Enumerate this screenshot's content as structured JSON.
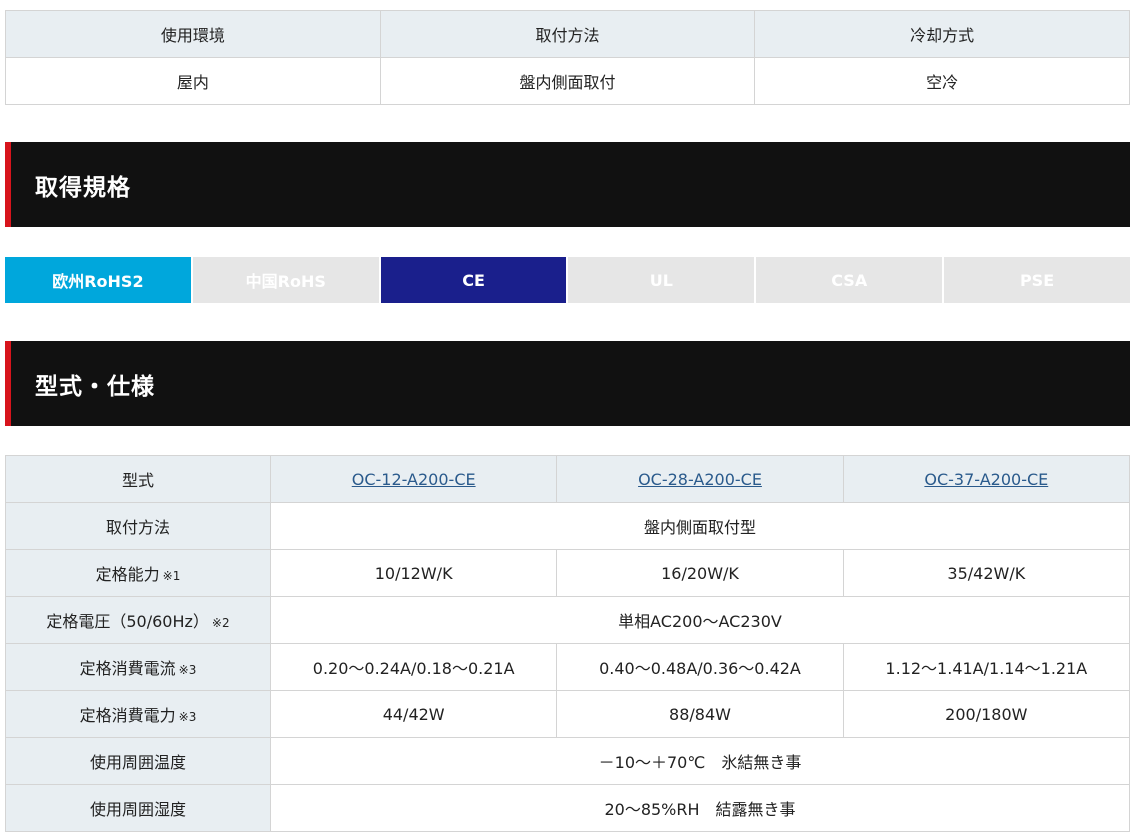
{
  "environment": {
    "headers": [
      "使用環境",
      "取付方法",
      "冷却方式"
    ],
    "values": [
      "屋内",
      "盤内側面取付",
      "空冷"
    ]
  },
  "certification": {
    "title": "取得規格",
    "items": [
      {
        "label": "欧州RoHS2",
        "state": "active",
        "color": "#00a7dc"
      },
      {
        "label": "中国RoHS",
        "state": "inactive"
      },
      {
        "label": "CE",
        "state": "active",
        "color": "#1a1f8c"
      },
      {
        "label": "UL",
        "state": "inactive"
      },
      {
        "label": "CSA",
        "state": "inactive"
      },
      {
        "label": "PSE",
        "state": "inactive"
      }
    ]
  },
  "spec": {
    "title": "型式・仕様",
    "model_label": "型式",
    "models": [
      "OC-12-A200-CE",
      "OC-28-A200-CE",
      "OC-37-A200-CE"
    ],
    "rows": {
      "mount": {
        "label": "取付方法",
        "value": "盤内側面取付型"
      },
      "capacity": {
        "label": "定格能力",
        "note": "※1",
        "values": [
          "10/12W/K",
          "16/20W/K",
          "35/42W/K"
        ]
      },
      "voltage": {
        "label": "定格電圧（50/60Hz）",
        "note": "※2",
        "value": "単相AC200～AC230V"
      },
      "current": {
        "label": "定格消費電流",
        "note": "※3",
        "values": [
          "0.20～0.24A/0.18～0.21A",
          "0.40～0.48A/0.36～0.42A",
          "1.12～1.41A/1.14～1.21A"
        ]
      },
      "power": {
        "label": "定格消費電力",
        "note": "※3",
        "values": [
          "44/42W",
          "88/84W",
          "200/180W"
        ]
      },
      "temp": {
        "label": "使用周囲温度",
        "value": "－10～＋70℃　氷結無き事"
      },
      "humidity": {
        "label": "使用周囲湿度",
        "value": "20～85%RH　結露無き事"
      }
    }
  },
  "colors": {
    "accent_red": "#d7141c",
    "header_bg": "#111111",
    "cell_label_bg": "#e8eef2",
    "link": "#2a5a8c"
  }
}
